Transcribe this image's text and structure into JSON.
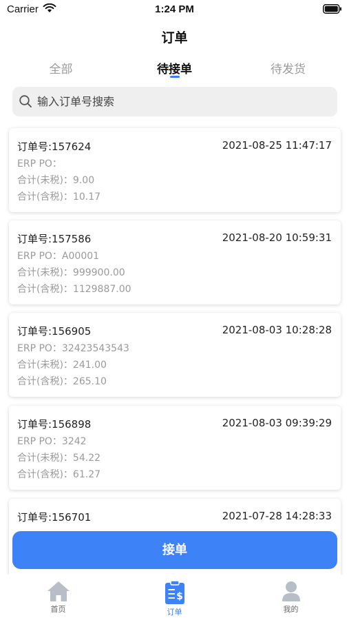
{
  "status_bar": {
    "carrier": "Carrier",
    "time": "1:24 PM"
  },
  "nav": {
    "title": "订单"
  },
  "tabs": [
    {
      "label": "全部"
    },
    {
      "label": "待接单",
      "active": true
    },
    {
      "label": "待发货"
    }
  ],
  "search": {
    "placeholder": "输入订单号搜索"
  },
  "orders": [
    {
      "order_no": "订单号:157624",
      "time": "2021-08-25 11:47:17",
      "erp_po": "ERP PO：",
      "total_excl": "合计(未税)：9.00",
      "total_incl": "合计(含税)：10.17"
    },
    {
      "order_no": "订单号:157586",
      "time": "2021-08-20 10:59:31",
      "erp_po": "ERP PO：A00001",
      "total_excl": "合计(未税)：999900.00",
      "total_incl": "合计(含税)：1129887.00"
    },
    {
      "order_no": "订单号:156905",
      "time": "2021-08-03 10:28:28",
      "erp_po": "ERP PO：32423543543",
      "total_excl": "合计(未税)：241.00",
      "total_incl": "合计(含税)：265.10"
    },
    {
      "order_no": "订单号:156898",
      "time": "2021-08-03 09:39:29",
      "erp_po": "ERP PO：3242",
      "total_excl": "合计(未税)：54.22",
      "total_incl": "合计(含税)：61.27"
    },
    {
      "order_no": "订单号:156701",
      "time": "2021-07-28 14:28:33",
      "erp_po": "",
      "total_excl": "",
      "total_incl": ""
    }
  ],
  "accept_button": {
    "label": "接单"
  },
  "tab_bar": [
    {
      "label": "首页",
      "icon": "home-icon"
    },
    {
      "label": "订单",
      "icon": "order-icon",
      "active": true
    },
    {
      "label": "我的",
      "icon": "profile-icon"
    }
  ],
  "colors": {
    "accent": "#3d82f6",
    "inactive_icon": "#b8bec8"
  }
}
